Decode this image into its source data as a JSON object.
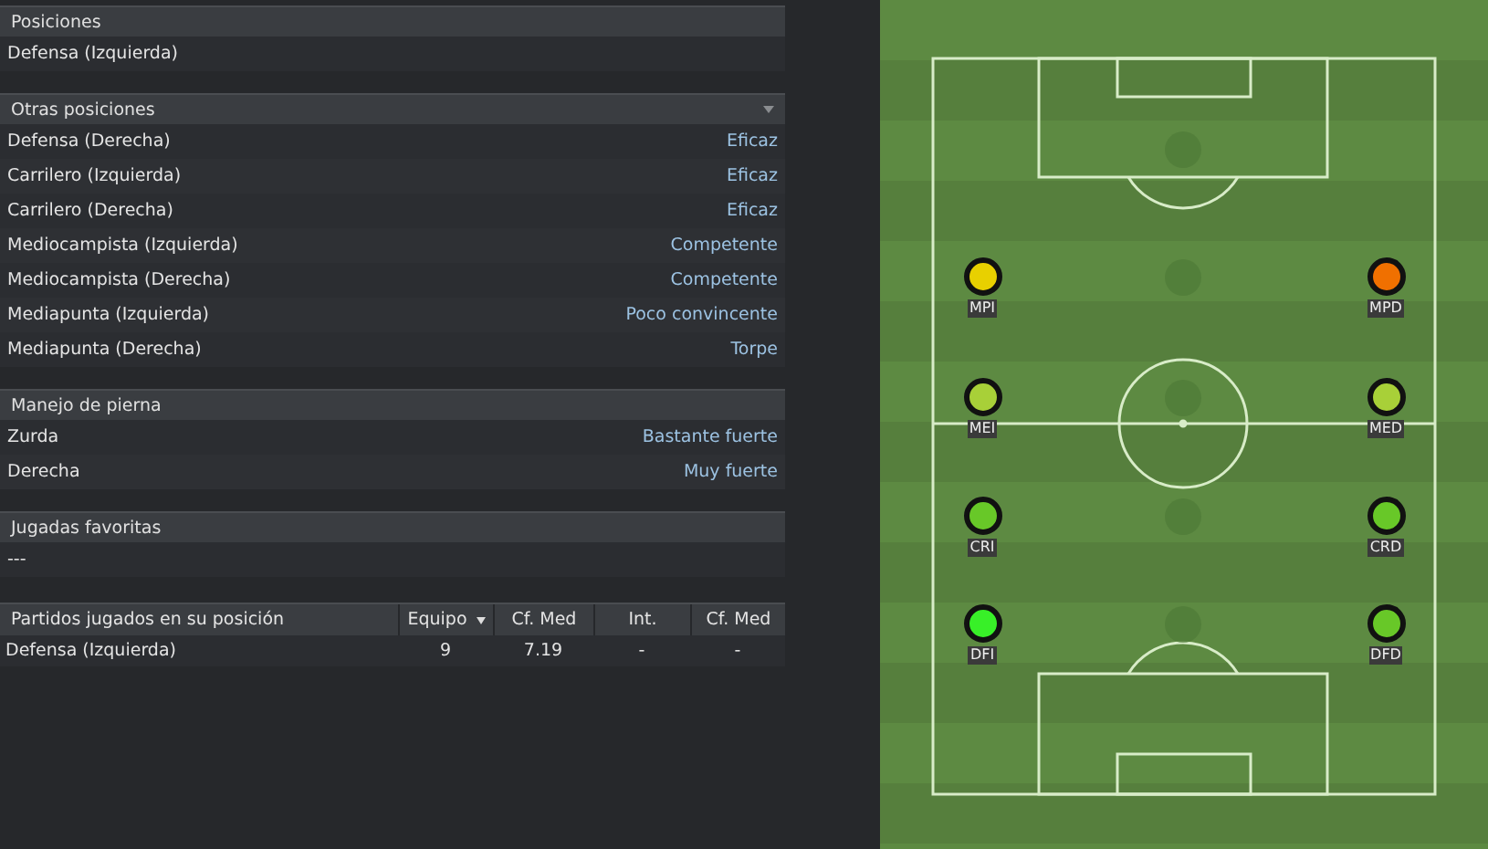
{
  "sections": [
    {
      "title": "Posiciones",
      "dropdown": false,
      "rows": [
        {
          "label": "Defensa (Izquierda)"
        }
      ]
    },
    {
      "title": "Otras posiciones",
      "dropdown": true,
      "rows": [
        {
          "label": "Defensa (Derecha)",
          "value": "Eficaz"
        },
        {
          "label": "Carrilero (Izquierda)",
          "value": "Eficaz"
        },
        {
          "label": "Carrilero (Derecha)",
          "value": "Eficaz"
        },
        {
          "label": "Mediocampista (Izquierda)",
          "value": "Competente"
        },
        {
          "label": "Mediocampista (Derecha)",
          "value": "Competente"
        },
        {
          "label": "Mediapunta (Izquierda)",
          "value": "Poco convincente"
        },
        {
          "label": "Mediapunta (Derecha)",
          "value": "Torpe"
        }
      ]
    },
    {
      "title": "Manejo de pierna",
      "dropdown": false,
      "rows": [
        {
          "label": "Zurda",
          "value": "Bastante fuerte"
        },
        {
          "label": "Derecha",
          "value": "Muy fuerte"
        }
      ]
    },
    {
      "title": "Jugadas favoritas",
      "dropdown": false,
      "rows": [
        {
          "label": "---"
        }
      ]
    }
  ],
  "table": {
    "columns": [
      {
        "label": "Partidos jugados en su posición",
        "sorted": false
      },
      {
        "label": "Equipo",
        "sorted": true
      },
      {
        "label": "Cf. Med",
        "sorted": false
      },
      {
        "label": "Int.",
        "sorted": false
      },
      {
        "label": "Cf. Med",
        "sorted": false
      }
    ],
    "rows": [
      [
        "Defensa (Izquierda)",
        "9",
        "7.19",
        "-",
        "-"
      ]
    ]
  },
  "pitch": {
    "lines": [
      {
        "left": {
          "code": "MPI",
          "color": "#e8d000"
        },
        "right": {
          "code": "MPD",
          "color": "#f07000"
        }
      },
      {
        "left": {
          "code": "MEI",
          "color": "#a8d038"
        },
        "right": {
          "code": "MED",
          "color": "#a8d038"
        }
      },
      {
        "left": {
          "code": "CRI",
          "color": "#68c828"
        },
        "right": {
          "code": "CRD",
          "color": "#68c828"
        }
      },
      {
        "left": {
          "code": "DFI",
          "color": "#38f028"
        },
        "right": {
          "code": "DFD",
          "color": "#68c828"
        }
      }
    ]
  }
}
